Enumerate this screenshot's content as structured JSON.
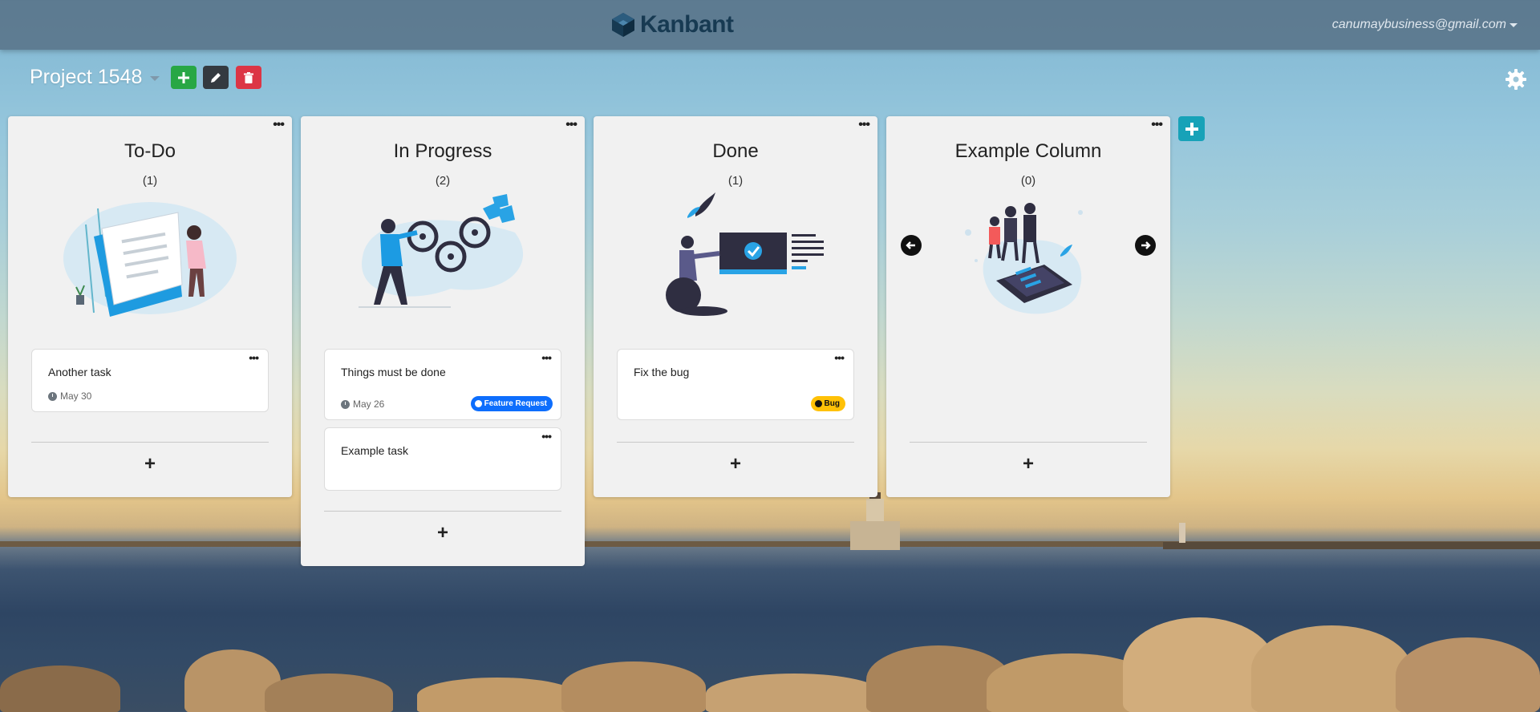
{
  "app": {
    "brand_name": "Kanbant",
    "user_email": "canumaybusiness@gmail.com"
  },
  "project": {
    "title": "Project 1548",
    "actions": [
      "add",
      "edit",
      "delete"
    ]
  },
  "columns": [
    {
      "title": "To-Do",
      "count": "(1)",
      "illustration": "documents-illustration",
      "tasks": [
        {
          "title": "Another task",
          "date": "May 30",
          "tag": ""
        }
      ]
    },
    {
      "title": "In Progress",
      "count": "(2)",
      "illustration": "gears-illustration",
      "tasks": [
        {
          "title": "Things must be done",
          "date": "May 26",
          "tag": "Feature Request"
        },
        {
          "title": "Example task",
          "date": "",
          "tag": ""
        }
      ]
    },
    {
      "title": "Done",
      "count": "(1)",
      "illustration": "checkmark-screen-illustration",
      "tasks": [
        {
          "title": "Fix the bug",
          "date": "",
          "tag": "Bug"
        }
      ]
    },
    {
      "title": "Example Column",
      "count": "(0)",
      "illustration": "phone-people-illustration",
      "tasks": []
    }
  ],
  "labels": {
    "menu_dots": "•••",
    "add_task": "+"
  },
  "colors": {
    "add_green": "#28a745",
    "edit_dark": "#343a40",
    "delete_red": "#dc3545",
    "add_column_teal": "#17a2b8",
    "feature_tag_blue": "#0d6efd",
    "bug_tag_yellow": "#ffc107"
  }
}
